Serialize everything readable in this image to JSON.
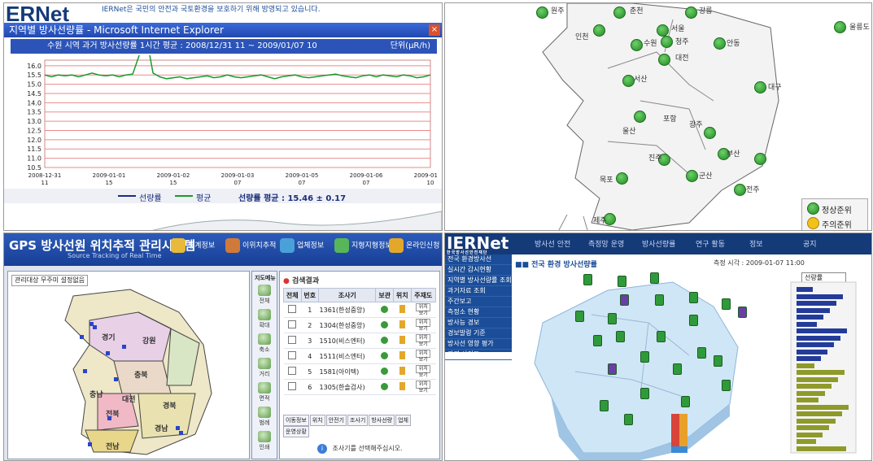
{
  "panel1": {
    "logo": "ERNet",
    "banner_text": "IERNet은 국민의 안전과 국토환경을 보호하기 위해 방영되고 있습니다.",
    "window_title": "지역별 방사선량률 - Microsoft Internet Explorer",
    "close_glyph": "×",
    "header_left": "수원 시역 과거 방사선량률 1시간 평균 : 2008/12/31 11 ~ 2009/01/07 10",
    "header_right": "단위(μR/h)",
    "chart_legend_series1": "선량률",
    "chart_legend_series2": "평균",
    "chart_legend_mean": "선량률 평균 : 15.46 ± 0.17"
  },
  "chart_data": {
    "type": "line",
    "ylabel": "",
    "ylim": [
      10.5,
      16.3
    ],
    "yticks": [
      "16.0",
      "15.5",
      "15.0",
      "14.5",
      "14.0",
      "13.5",
      "13.0",
      "12.5",
      "12.0",
      "11.5",
      "11.0",
      "10.5"
    ],
    "xticks": [
      "2008-12-31\n11",
      "2009-01-01\n15",
      "2009-01-02\n15",
      "2009-01-03\n07",
      "2009-01-05\n07",
      "2009-01-06\n07",
      "2009-01-07\n10"
    ],
    "series": [
      {
        "name": "선량률",
        "values": [
          15.5,
          15.4,
          15.5,
          15.45,
          15.5,
          15.4,
          15.5,
          15.6,
          15.5,
          15.45,
          15.5,
          15.4,
          15.5,
          15.55,
          16.6,
          17.6,
          15.6,
          15.4,
          15.3,
          15.35,
          15.4,
          15.3,
          15.35,
          15.4,
          15.45,
          15.35,
          15.4,
          15.5,
          15.4,
          15.35,
          15.4,
          15.45,
          15.5,
          15.4,
          15.3,
          15.4,
          15.45,
          15.5,
          15.4,
          15.35,
          15.4,
          15.45,
          15.5,
          15.55,
          15.45,
          15.4,
          15.35,
          15.45,
          15.5,
          15.4,
          15.5,
          15.45,
          15.4,
          15.5,
          15.45,
          15.35,
          15.4,
          15.5
        ]
      },
      {
        "name": "평균",
        "values": []
      }
    ],
    "grid": true
  },
  "panel2": {
    "stations": [
      {
        "name": "원주"
      },
      {
        "name": "춘천"
      },
      {
        "name": "강릉"
      },
      {
        "name": "인천"
      },
      {
        "name": "서울"
      },
      {
        "name": "울릉도"
      },
      {
        "name": "수원"
      },
      {
        "name": "청주"
      },
      {
        "name": "안동"
      },
      {
        "name": "서산"
      },
      {
        "name": "대전"
      },
      {
        "name": "대구"
      },
      {
        "name": "포항"
      },
      {
        "name": "울산"
      },
      {
        "name": "광주"
      },
      {
        "name": "진주"
      },
      {
        "name": "부산"
      },
      {
        "name": "목포"
      },
      {
        "name": "군산"
      },
      {
        "name": "전주"
      },
      {
        "name": "제주"
      }
    ],
    "legend_normal": "정상준위",
    "legend_alert": "주의준위"
  },
  "panel3": {
    "title": "GPS 방사선원 위치추적 관리시스템",
    "subtitle": "Source Tracking of Real Time",
    "nav": [
      "통계정보",
      "이위치추적",
      "업체정보",
      "지형지형정보",
      "온라인신청"
    ],
    "map_search": "관리대상 무주미 설정없음",
    "regions": [
      "경기",
      "강원",
      "충북",
      "충남",
      "전북",
      "경북",
      "경남",
      "전남",
      "대전"
    ],
    "tools": [
      "전체",
      "확대",
      "축소",
      "거리",
      "면적",
      "범례",
      "인쇄"
    ],
    "results_title": "검색결과",
    "table_headers": [
      "전체",
      "번호",
      "조사기",
      "보관",
      "위치",
      "주재도"
    ],
    "rows": [
      {
        "no": "1",
        "device": "1361(한성중앙)",
        "btn": "위치보기"
      },
      {
        "no": "2",
        "device": "1304(한성중앙)",
        "btn": "위치보기"
      },
      {
        "no": "3",
        "device": "1510(비스엔터)",
        "btn": "위치보기"
      },
      {
        "no": "4",
        "device": "1511(비스엔터)",
        "btn": "위치보기"
      },
      {
        "no": "5",
        "device": "1581(아이텍)",
        "btn": "위치보기"
      },
      {
        "no": "6",
        "device": "1305(한솔검사)",
        "btn": "위치보기"
      }
    ],
    "tabs": [
      "이동정보",
      "위치",
      "안전기",
      "조사기",
      "방사선량",
      "업체",
      "운영상황"
    ],
    "hint": "조사기를 선택해주십시오."
  },
  "panel4": {
    "logo": "IERNet",
    "logo_sub": "한국방사선안전재단",
    "menu": [
      "방사선 안전",
      "측정망 운영",
      "방사선량률",
      "연구 활동",
      "정보",
      "공지"
    ],
    "side_items": [
      "전국 환경방사선",
      "실시간 감시현황",
      "지역별 방사선량률 조회",
      "과거자료 조회",
      "주간보고",
      "측정소 현황",
      "방사능 경보",
      "경보발령 기준",
      "방사선 영향 평가",
      "관련 사이트"
    ],
    "heading": "전국 환경 방사선량률",
    "time_label": "측정 시각 : 2009-01-07 11:00",
    "select_value": "선량률",
    "colors": {
      "accent": "#143a78",
      "bar_blue": "#233c9a",
      "bar_olive": "#8e9a2a"
    }
  }
}
